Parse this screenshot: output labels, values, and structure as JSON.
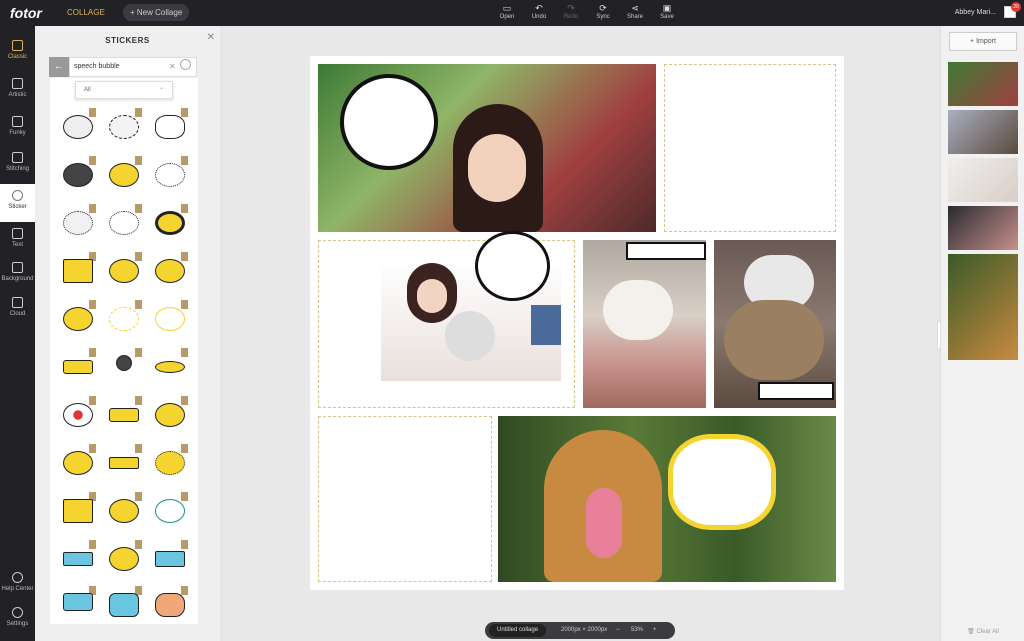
{
  "app": {
    "logo": "fotor",
    "mode": "COLLAGE",
    "new_collage": "New Collage"
  },
  "toolbar": {
    "open": "Open",
    "undo": "Undo",
    "redo": "Redo",
    "sync": "Sync",
    "share": "Share",
    "save": "Save"
  },
  "user": {
    "name": "Abbey Mari...",
    "notifications": "20"
  },
  "nav": [
    {
      "label": "Classic"
    },
    {
      "label": "Artistic"
    },
    {
      "label": "Funky"
    },
    {
      "label": "Stitching"
    },
    {
      "label": "Sticker"
    },
    {
      "label": "Text"
    },
    {
      "label": "Background"
    },
    {
      "label": "Cloud"
    },
    {
      "label": "Help Center"
    },
    {
      "label": "Settings"
    }
  ],
  "panel": {
    "title": "STICKERS",
    "search_value": "speech bubble",
    "filter": "All"
  },
  "right": {
    "import": "Import",
    "clear_all": "Clear All"
  },
  "status": {
    "doc_name": "Untitled collage",
    "size": "2000px × 2000px",
    "zoom": "53%"
  },
  "colors": {
    "accent": "#d9b35c",
    "dark": "#222226",
    "sticker_yellow": "#f6d430",
    "sticker_blue": "#6ac6e0",
    "sticker_orange": "#f0a878"
  }
}
